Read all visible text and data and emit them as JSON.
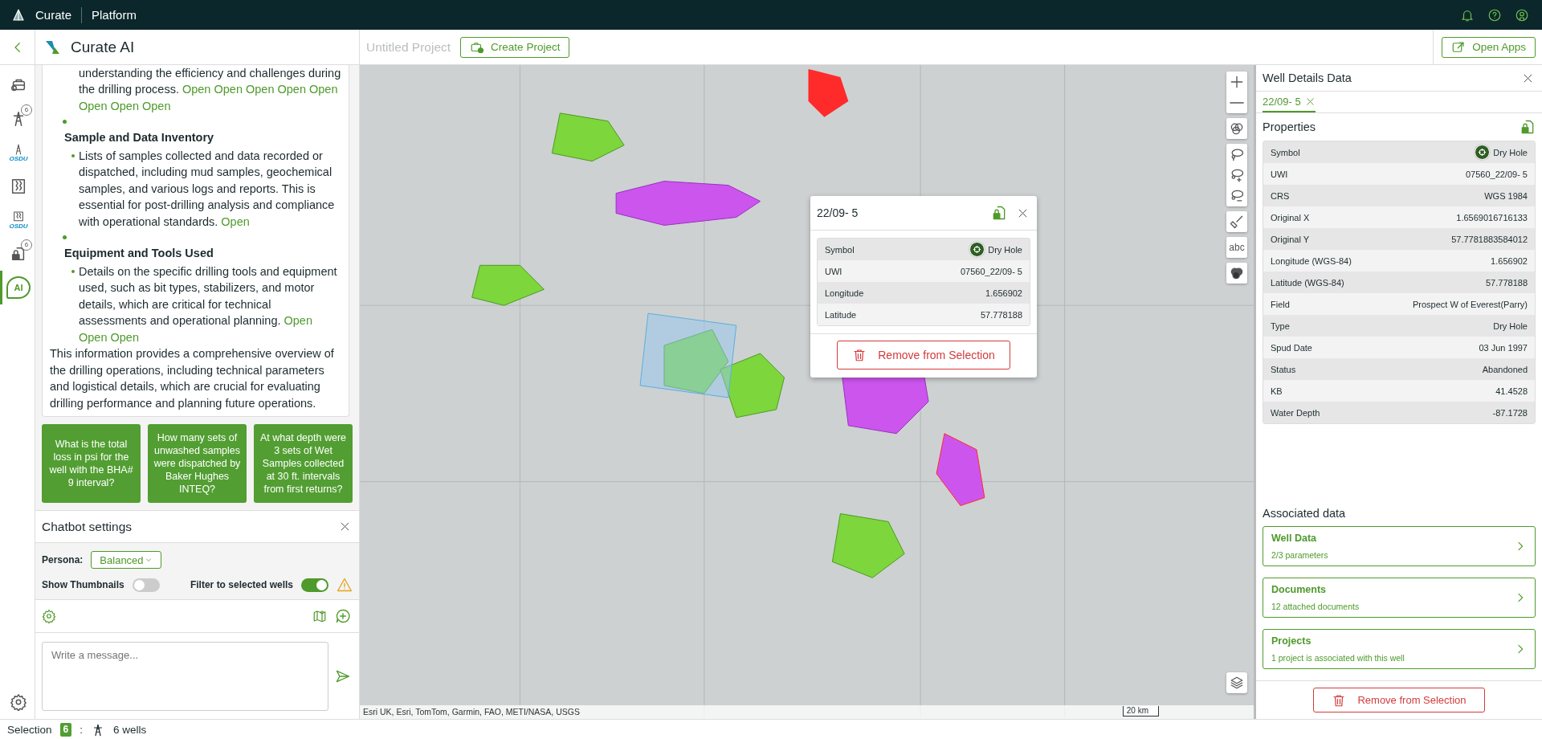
{
  "top_bar": {
    "brand": "Curate",
    "section": "Platform"
  },
  "chat": {
    "title": "Curate AI",
    "rail": [
      {
        "kind": "briefcase",
        "selected": false
      },
      {
        "kind": "derrick",
        "badge": "6",
        "selected": false
      },
      {
        "kind": "osdu-derrick",
        "label": "OSDU",
        "selected": false
      },
      {
        "kind": "box",
        "selected": false
      },
      {
        "kind": "osdu-box",
        "label": "OSDU",
        "selected": false
      },
      {
        "kind": "lock",
        "badge": "6",
        "selected": false
      },
      {
        "kind": "ai",
        "label": "AI",
        "selected": true
      }
    ],
    "content": [
      {
        "kind": "continuation",
        "text": "understanding the efficiency and challenges during the drilling process.",
        "links": [
          "Open",
          "Open",
          "Open",
          "Open",
          "Open",
          "Open",
          "Open",
          "Open"
        ]
      },
      {
        "kind": "section",
        "heading": "Sample and Data Inventory",
        "bullets": [
          {
            "text": "Lists of samples collected and data recorded or dispatched, including mud samples, geochemical samples, and various logs and reports. This is essential for post-drilling analysis and compliance with operational standards.",
            "links": [
              "Open"
            ]
          }
        ]
      },
      {
        "kind": "section",
        "heading": "Equipment and Tools Used",
        "bullets": [
          {
            "text": "Details on the specific drilling tools and equipment used, such as bit types, stabilizers, and motor details, which are critical for technical assessments and operational planning.",
            "links": [
              "Open",
              "Open",
              "Open"
            ]
          }
        ]
      },
      {
        "kind": "paragraph",
        "text": "This information provides a comprehensive overview of the drilling operations, including technical parameters and logistical details, which are crucial for evaluating drilling performance and planning future operations."
      }
    ],
    "suggestions": [
      "What is the total loss in psi for the well with the BHA# 9 interval?",
      "How many sets of unwashed samples were dispatched by Baker Hughes INTEQ?",
      "At what depth were 3 sets of Wet Samples collected at 30 ft. intervals from first returns?"
    ],
    "settings": {
      "title": "Chatbot settings",
      "persona_label": "Persona:",
      "persona": "Balanced",
      "thumbnails_label": "Show Thumbnails",
      "thumbnails_on": false,
      "filter_label": "Filter to selected wells",
      "filter_on": true,
      "warning": true
    },
    "input": {
      "placeholder": "Write a message..."
    }
  },
  "project_bar": {
    "title": "Untitled Project",
    "create_button": "Create Project",
    "open_apps_button": "Open Apps"
  },
  "map": {
    "tools": [
      {
        "kind": "zoom-in"
      },
      {
        "kind": "zoom-out"
      },
      {
        "kind": "circles"
      },
      {
        "kind": "lasso"
      },
      {
        "kind": "lasso-add"
      },
      {
        "kind": "lasso-remove"
      },
      {
        "kind": "broom"
      },
      {
        "kind": "text",
        "label": "abc"
      },
      {
        "kind": "blend"
      }
    ],
    "attribution": "Esri UK, Esri, TomTom, Garmin, FAO, METI/NASA, USGS",
    "scale": "20 km",
    "popup": {
      "title": "22/09- 5",
      "rows": [
        {
          "kind": "symbol",
          "label": "Symbol",
          "value": "Dry Hole"
        },
        {
          "kind": "text",
          "label": "UWI",
          "value": "07560_22/09- 5"
        },
        {
          "kind": "text",
          "label": "Longitude",
          "value": "1.656902"
        },
        {
          "kind": "text",
          "label": "Latitude",
          "value": "57.778188"
        }
      ],
      "remove_button": "Remove from Selection"
    }
  },
  "details": {
    "title": "Well Details Data",
    "tabs": [
      {
        "label": "22/09- 5",
        "selected": true
      }
    ],
    "properties_title": "Properties",
    "rows": [
      {
        "kind": "symbol",
        "label": "Symbol",
        "value": "Dry Hole"
      },
      {
        "kind": "text",
        "label": "UWI",
        "value": "07560_22/09- 5"
      },
      {
        "kind": "text",
        "label": "CRS",
        "value": "WGS 1984"
      },
      {
        "kind": "text",
        "label": "Original X",
        "value": "1.6569016716133"
      },
      {
        "kind": "text",
        "label": "Original Y",
        "value": "57.7781883584012"
      },
      {
        "kind": "text",
        "label": "Longitude (WGS-84)",
        "value": "1.656902"
      },
      {
        "kind": "text",
        "label": "Latitude (WGS-84)",
        "value": "57.778188"
      },
      {
        "kind": "text",
        "label": "Field",
        "value": "Prospect W of Everest(Parry)"
      },
      {
        "kind": "text",
        "label": "Type",
        "value": "Dry Hole"
      },
      {
        "kind": "text",
        "label": "Spud Date",
        "value": "03 Jun 1997"
      },
      {
        "kind": "text",
        "label": "Status",
        "value": "Abandoned"
      },
      {
        "kind": "text",
        "label": "KB",
        "value": "41.4528"
      },
      {
        "kind": "text",
        "label": "Water Depth",
        "value": "-87.1728"
      }
    ],
    "associated_title": "Associated data",
    "cards": [
      {
        "title": "Well Data",
        "subtitle": "2/3 parameters"
      },
      {
        "title": "Documents",
        "subtitle": "12 attached documents"
      },
      {
        "title": "Projects",
        "subtitle": "1 project is associated with this well"
      }
    ],
    "remove_button": "Remove from Selection"
  },
  "status_bar": {
    "label": "Selection",
    "count": "6",
    "separator": ":",
    "wells": "6 wells"
  }
}
